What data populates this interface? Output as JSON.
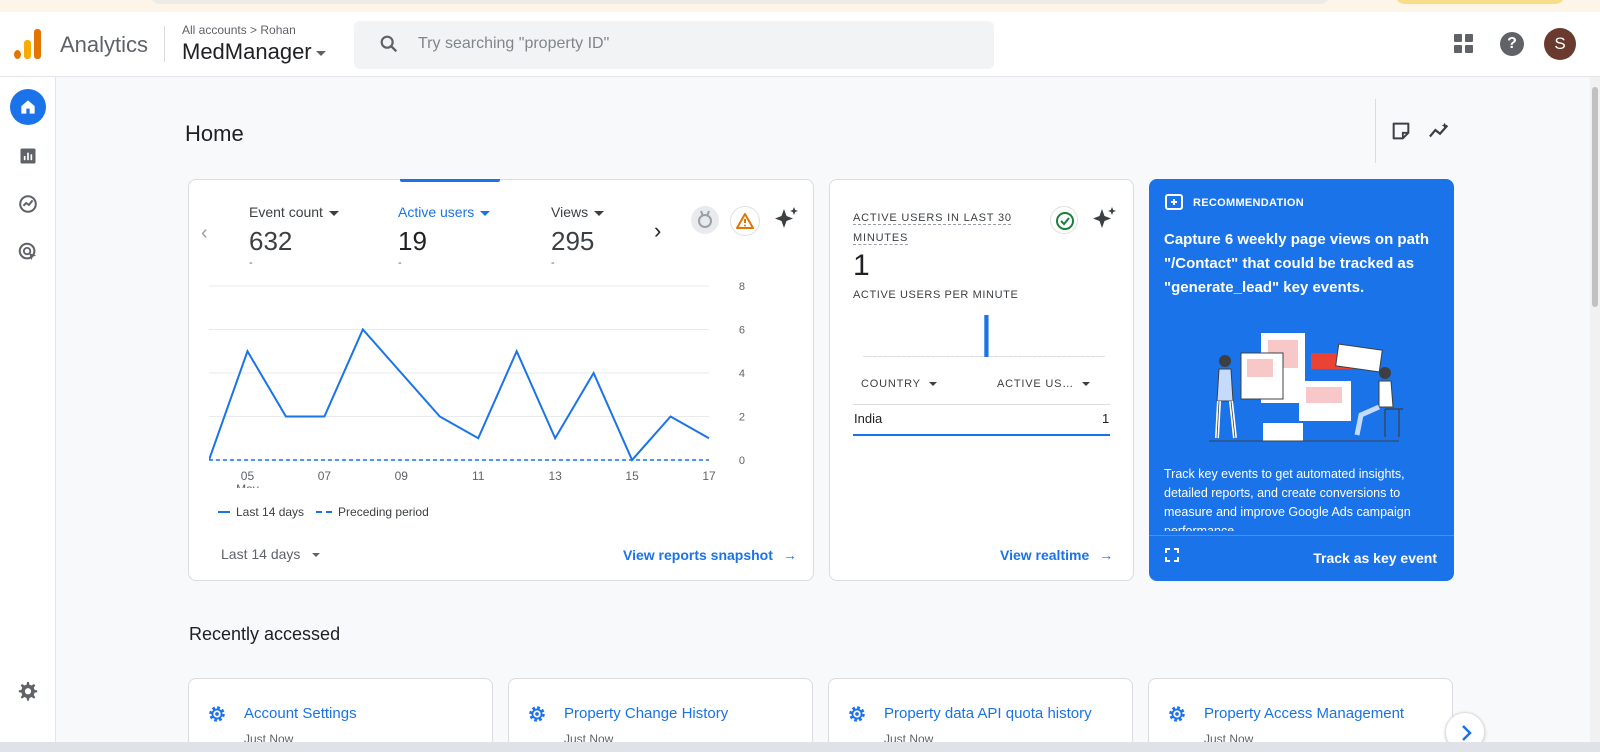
{
  "header": {
    "brand": "Analytics",
    "breadcrumb": "All accounts > Rohan",
    "account": "MedManager",
    "search_placeholder": "Try searching \"property ID\"",
    "avatar_initial": "S",
    "help_label": "?"
  },
  "page": {
    "title": "Home"
  },
  "overview": {
    "metrics": [
      {
        "label": "Event count",
        "value": "632",
        "change": "-"
      },
      {
        "label": "Active users",
        "value": "19",
        "change": "-"
      },
      {
        "label": "Views",
        "value": "295",
        "change": "-"
      }
    ],
    "legend": {
      "current": "Last 14 days",
      "previous": "Preceding period"
    },
    "date_range": "Last 14 days",
    "link": "View reports snapshot"
  },
  "chart_data": {
    "type": "line",
    "x": [
      "04",
      "05",
      "06",
      "07",
      "08",
      "09",
      "10",
      "11",
      "12",
      "13",
      "14",
      "15",
      "16",
      "17",
      "18"
    ],
    "xtick_labels": [
      "05",
      "07",
      "09",
      "11",
      "13",
      "15",
      "17"
    ],
    "xtick_sublabel": "May",
    "series": [
      {
        "name": "Last 14 days",
        "values": [
          0,
          5,
          2,
          2,
          6,
          4,
          2,
          1,
          5,
          1,
          4,
          0,
          2,
          1
        ],
        "style": "solid"
      },
      {
        "name": "Preceding period",
        "values": [
          0,
          0,
          0,
          0,
          0,
          0,
          0,
          0,
          0,
          0,
          0,
          0,
          0,
          0
        ],
        "style": "dashed"
      }
    ],
    "ylim": [
      0,
      8
    ],
    "yticks": [
      "0",
      "2",
      "4",
      "6",
      "8"
    ],
    "grid": true,
    "color": "#1a73e8"
  },
  "realtime": {
    "title": "ACTIVE USERS IN LAST 30 MINUTES",
    "value": "1",
    "subtitle": "ACTIVE USERS PER MINUTE",
    "minute_values": [
      0,
      0,
      0,
      0,
      0,
      0,
      0,
      0,
      0,
      0,
      0,
      0,
      0,
      0,
      0,
      0,
      0,
      0,
      0,
      0,
      0,
      0,
      0,
      0,
      0,
      1,
      0,
      0,
      0,
      0,
      0,
      0,
      0,
      0,
      0,
      0,
      0,
      0,
      0,
      0,
      0,
      0,
      0,
      0,
      0,
      0,
      0,
      0,
      0,
      0
    ],
    "col_country": "COUNTRY",
    "col_users": "ACTIVE US…",
    "rows": [
      {
        "country": "India",
        "users": "1"
      }
    ],
    "link": "View realtime"
  },
  "recommendation": {
    "label": "RECOMMENDATION",
    "title": "Capture 6 weekly page views on path \"/Contact\" that could be tracked as \"generate_lead\" key events.",
    "description": "Track key events to get automated insights, detailed reports, and create conversions to measure and improve Google Ads campaign performance.",
    "action": "Track as key event"
  },
  "recent": {
    "title": "Recently accessed",
    "items": [
      {
        "title": "Account Settings",
        "time": "Just Now"
      },
      {
        "title": "Property Change History",
        "time": "Just Now"
      },
      {
        "title": "Property data API quota history",
        "time": "Just Now"
      },
      {
        "title": "Property Access Management",
        "time": "Just Now"
      }
    ]
  },
  "colors": {
    "accent": "#1a73e8",
    "logo_orange": "#f9ab00",
    "logo_dark": "#e37400",
    "avatar": "#6b3a2e"
  },
  "icons": [
    "home-icon",
    "reports-icon",
    "explore-icon",
    "advertising-icon",
    "admin-gear-icon",
    "search-icon",
    "apps-grid-icon",
    "help-icon",
    "note-icon",
    "insights-icon",
    "sparkle-icon",
    "check-icon",
    "warning-icon",
    "medal-icon",
    "expand-icon"
  ]
}
